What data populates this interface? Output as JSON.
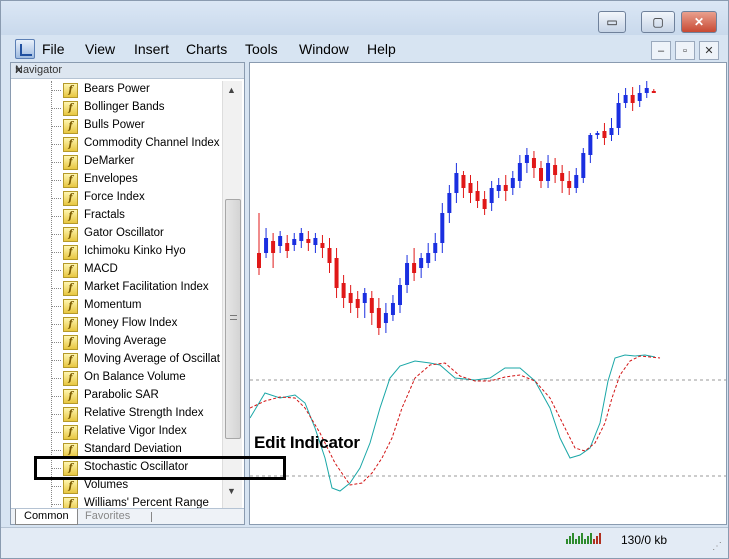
{
  "menu": [
    "File",
    "View",
    "Insert",
    "Charts",
    "Tools",
    "Window",
    "Help"
  ],
  "window_controls": {
    "minimize": "▭",
    "maximize": "▢",
    "close": "✕"
  },
  "mdi_controls": {
    "minimize": "–",
    "restore": "▫",
    "close": "✕"
  },
  "navigator": {
    "title": "Navigator",
    "close": "×",
    "items": [
      "Bears Power",
      "Bollinger Bands",
      "Bulls Power",
      "Commodity Channel Index",
      "DeMarker",
      "Envelopes",
      "Force Index",
      "Fractals",
      "Gator Oscillator",
      "Ichimoku Kinko Hyo",
      "MACD",
      "Market Facilitation Index",
      "Momentum",
      "Money Flow Index",
      "Moving Average",
      "Moving Average of Oscillat",
      "On Balance Volume",
      "Parabolic SAR",
      "Relative Strength Index",
      "Relative Vigor Index",
      "Standard Deviation",
      "Stochastic Oscillator",
      "Volumes",
      "Williams' Percent Range"
    ],
    "selected_item": "Stochastic Oscillator",
    "tabs": [
      "Common",
      "Favorites"
    ]
  },
  "callout": {
    "text": "Edit Indicator"
  },
  "status": {
    "text": "130/0 kb"
  },
  "colors": {
    "bull": "#1a2fe0",
    "bear": "#e01818",
    "fast_line": "#1aa7a7",
    "slow_line": "#d21414"
  }
}
